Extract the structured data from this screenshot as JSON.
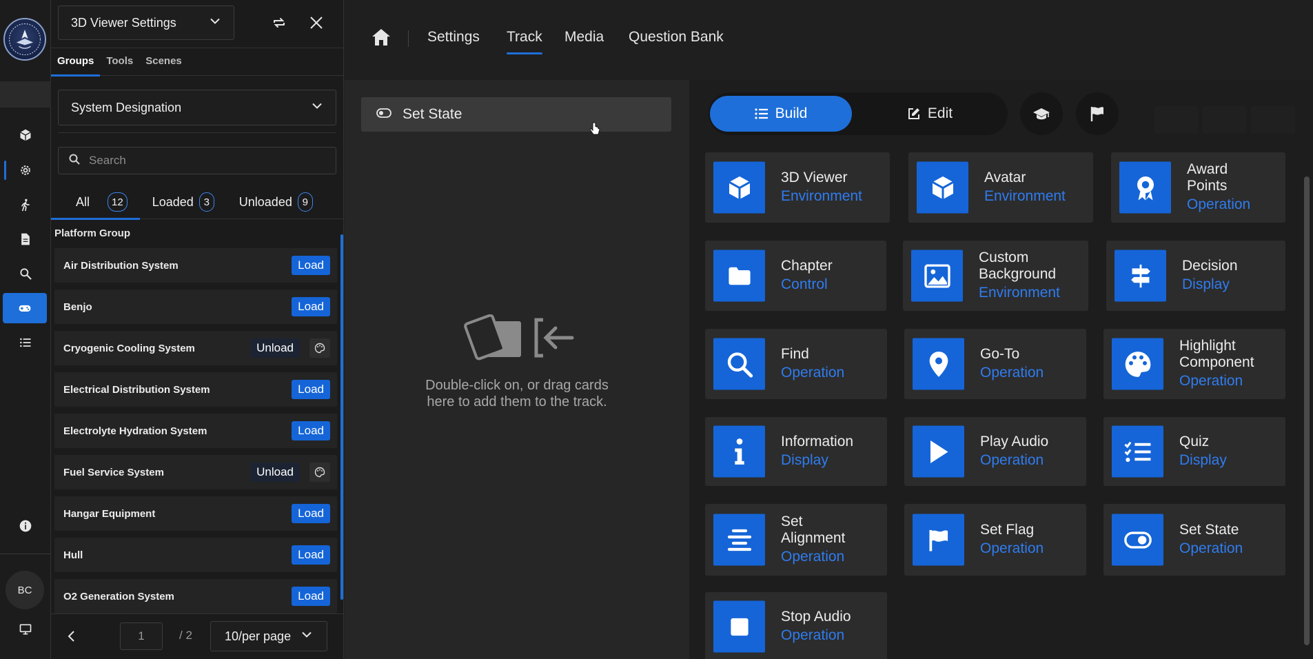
{
  "panel": {
    "dropdown": "3D Viewer Settings",
    "subtabs": [
      "Groups",
      "Tools",
      "Scenes"
    ],
    "group_select": "System Designation",
    "search_placeholder": "Search",
    "filters": [
      {
        "label": "All",
        "count": "12"
      },
      {
        "label": "Loaded",
        "count": "3"
      },
      {
        "label": "Unloaded",
        "count": "9"
      }
    ],
    "group_heading": "Platform Group",
    "items": [
      {
        "name": "Air Distribution System",
        "action": "Load"
      },
      {
        "name": "Benjo",
        "action": "Load"
      },
      {
        "name": "Cryogenic Cooling System",
        "action": "Unload"
      },
      {
        "name": "Electrical Distribution System",
        "action": "Load"
      },
      {
        "name": "Electrolyte Hydration System",
        "action": "Load"
      },
      {
        "name": "Fuel Service System",
        "action": "Unload"
      },
      {
        "name": "Hangar Equipment",
        "action": "Load"
      },
      {
        "name": "Hull",
        "action": "Load"
      },
      {
        "name": "O2 Generation System",
        "action": "Load"
      }
    ],
    "pager": {
      "page": "1",
      "total": "/ 2",
      "per_page": "10/per page"
    }
  },
  "rail": {
    "avatar": "BC"
  },
  "nav": {
    "tabs": [
      "Settings",
      "Track",
      "Media",
      "Question Bank"
    ],
    "active": "Track"
  },
  "track": {
    "card_label": "Set State",
    "hint": "Double-click on, or drag cards here to add them to the track."
  },
  "mode": {
    "build": "Build",
    "edit": "Edit"
  },
  "tiles": [
    {
      "title": "3D Viewer",
      "category": "Environment",
      "icon": "cube-icon"
    },
    {
      "title": "Avatar",
      "category": "Environment",
      "icon": "cube-icon"
    },
    {
      "title": "Award Points",
      "category": "Operation",
      "icon": "award-icon"
    },
    {
      "title": "Chapter",
      "category": "Control",
      "icon": "folder-icon"
    },
    {
      "title": "Custom Background",
      "category": "Environment",
      "icon": "image-icon"
    },
    {
      "title": "Decision",
      "category": "Display",
      "icon": "signpost-icon"
    },
    {
      "title": "Find",
      "category": "Operation",
      "icon": "search-icon"
    },
    {
      "title": "Go-To",
      "category": "Operation",
      "icon": "map-pin-icon"
    },
    {
      "title": "Highlight Component",
      "category": "Operation",
      "icon": "palette-icon"
    },
    {
      "title": "Information",
      "category": "Display",
      "icon": "info-icon"
    },
    {
      "title": "Play Audio",
      "category": "Operation",
      "icon": "play-icon"
    },
    {
      "title": "Quiz",
      "category": "Display",
      "icon": "checklist-icon"
    },
    {
      "title": "Set Alignment",
      "category": "Operation",
      "icon": "align-center-icon"
    },
    {
      "title": "Set Flag",
      "category": "Operation",
      "icon": "flag-icon"
    },
    {
      "title": "Set State",
      "category": "Operation",
      "icon": "toggle-icon"
    },
    {
      "title": "Stop Audio",
      "category": "Operation",
      "icon": "stop-icon"
    }
  ],
  "colors": {
    "accent": "#1e6fd9",
    "category_text": "#2f7cf0",
    "background": "#1f1f1f"
  }
}
